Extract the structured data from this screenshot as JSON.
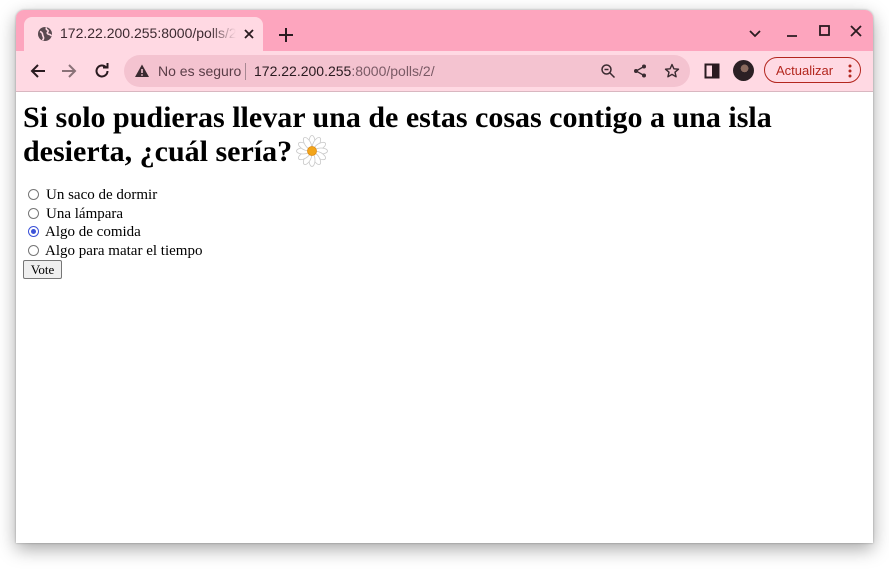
{
  "tab": {
    "title": "172.22.200.255:8000/polls/2/"
  },
  "omnibox": {
    "security_label": "No es seguro",
    "url_host": "172.22.200.255",
    "url_rest": ":8000/polls/2/"
  },
  "toolbar": {
    "update_label": "Actualizar"
  },
  "poll": {
    "question": "Si solo pudieras llevar una de estas cosas contigo a una isla desierta, ¿cuál sería?",
    "choices": [
      {
        "label": "Un saco de dormir",
        "selected": false
      },
      {
        "label": "Una lámpara",
        "selected": false
      },
      {
        "label": "Algo de comida",
        "selected": true
      },
      {
        "label": "Algo para matar el tiempo",
        "selected": false
      }
    ],
    "vote_label": "Vote"
  },
  "colors": {
    "titlebar": "#fda5be",
    "toolbar": "#ffd9e3",
    "omnibox": "#f4c3d0",
    "accent": "#b3261e",
    "radio_selected": "#3c52d8"
  },
  "icons": {
    "tab": "globe-icon",
    "tab_close": "close-icon",
    "new_tab": "plus-icon",
    "back": "arrow-left-icon",
    "forward": "arrow-right-icon",
    "reload": "reload-icon",
    "warning": "warning-icon",
    "zoom": "zoom-out-icon",
    "share": "share-icon",
    "bookmark": "star-icon",
    "side_panel": "side-panel-icon",
    "menu": "kebab-menu-icon",
    "question_emoji": "daisy-icon"
  }
}
